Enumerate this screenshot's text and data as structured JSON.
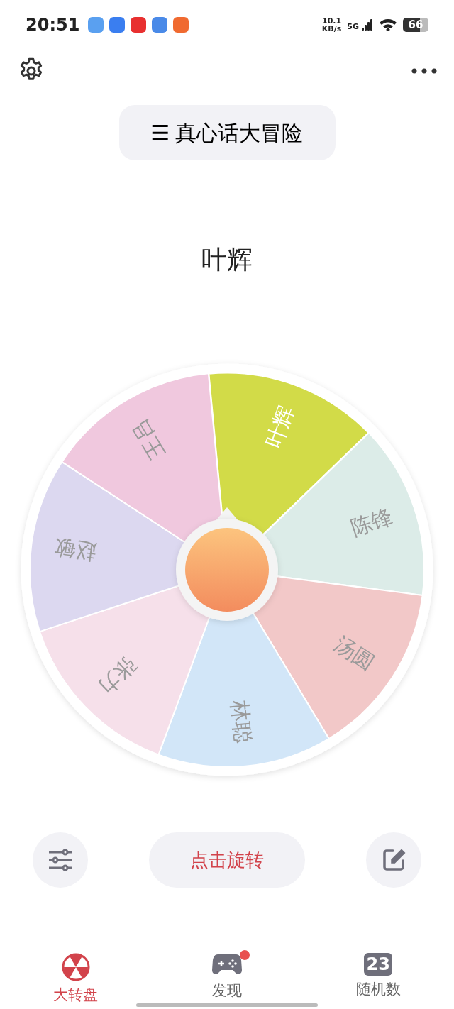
{
  "status_bar": {
    "time": "20:51",
    "speed": "10.1",
    "speed_unit": "KB/s",
    "network": "5G",
    "battery": "66"
  },
  "toolbar": {
    "title_icon": "☰",
    "title": "真心话大冒险"
  },
  "result": "叶辉",
  "wheel": {
    "segments": [
      {
        "label": "叶辉",
        "color": "#d2db48",
        "selected": true
      },
      {
        "label": "陈锋",
        "color": "#dcece8",
        "selected": false
      },
      {
        "label": "汤圆",
        "color": "#f2c8c8",
        "selected": false
      },
      {
        "label": "林聪",
        "color": "#d2e6f8",
        "selected": false
      },
      {
        "label": "张力",
        "color": "#f6e0ea",
        "selected": false
      },
      {
        "label": "赵敏",
        "color": "#dcd8f0",
        "selected": false
      },
      {
        "label": "王吕",
        "color": "#f0c8de",
        "selected": false
      }
    ]
  },
  "spin_button": "点击旋转",
  "nav": [
    {
      "label": "大转盘",
      "kind": "wheel",
      "selected": true,
      "badge": false
    },
    {
      "label": "发现",
      "kind": "gamepad",
      "selected": false,
      "badge": true
    },
    {
      "label": "随机数",
      "kind": "number",
      "icon_text": "23",
      "selected": false,
      "badge": false
    }
  ]
}
